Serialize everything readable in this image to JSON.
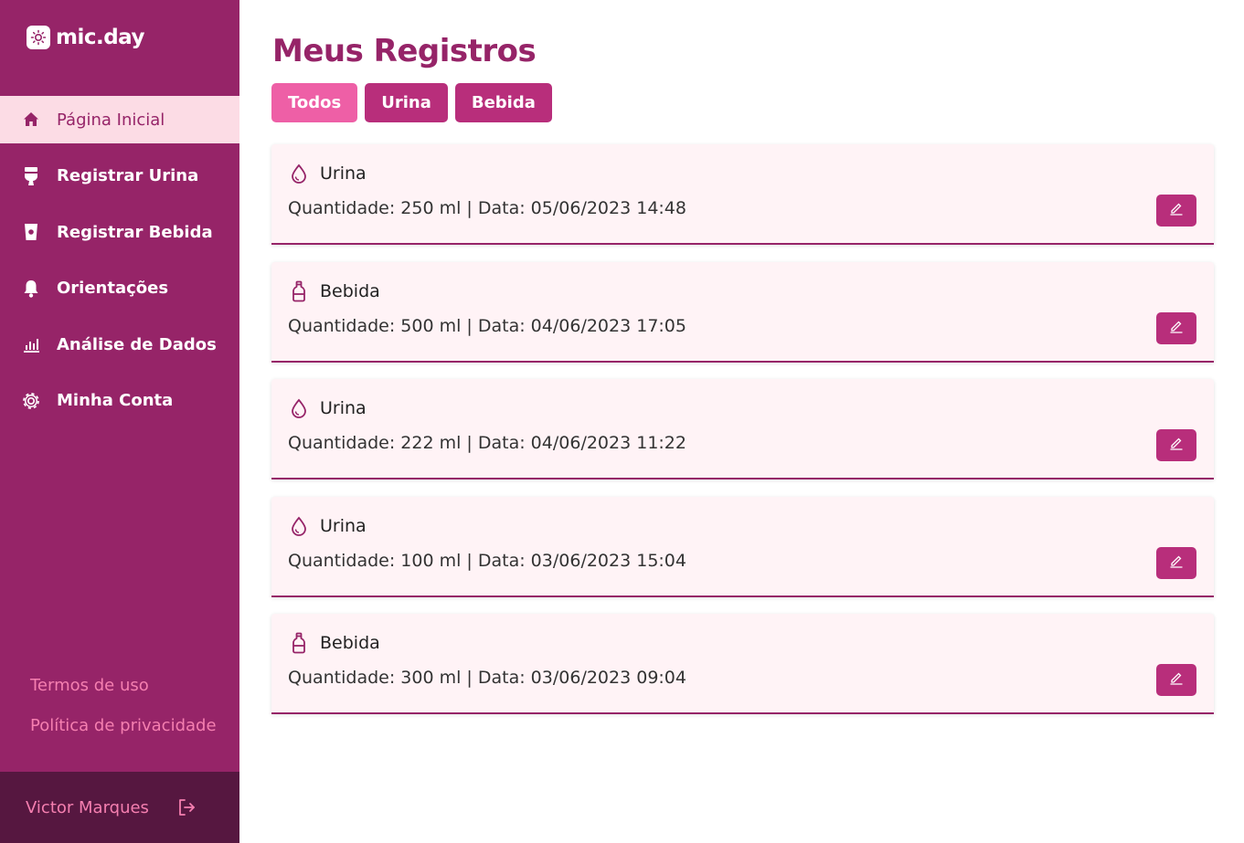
{
  "app": {
    "name": "mic.day",
    "accent": "#962468",
    "accent_light": "#fcdce5",
    "button_color": "#b82e7b",
    "active_filter_color": "#ee5fa6",
    "link_color": "#f57fb0"
  },
  "sidebar": {
    "items": [
      {
        "label": "Página Inicial",
        "icon": "home-icon",
        "active": true
      },
      {
        "label": "Registrar Urina",
        "icon": "toilet-icon",
        "active": false
      },
      {
        "label": "Registrar Bebida",
        "icon": "cup-icon",
        "active": false
      },
      {
        "label": "Orientações",
        "icon": "bell-icon",
        "active": false
      },
      {
        "label": "Análise de Dados",
        "icon": "bar-chart-icon",
        "active": false
      },
      {
        "label": "Minha Conta",
        "icon": "gear-icon",
        "active": false
      }
    ],
    "footer_links": [
      "Termos de uso",
      "Política de privacidade"
    ],
    "user": {
      "name": "Victor Marques",
      "logout_icon": "logout-icon"
    }
  },
  "main": {
    "title": "Meus Registros",
    "filters": [
      {
        "label": "Todos",
        "active": true
      },
      {
        "label": "Urina",
        "active": false
      },
      {
        "label": "Bebida",
        "active": false
      }
    ],
    "records": [
      {
        "type": "Urina",
        "icon": "drop-icon",
        "detail": "Quantidade: 250 ml | Data: 05/06/2023 14:48"
      },
      {
        "type": "Bebida",
        "icon": "bottle-icon",
        "detail": "Quantidade: 500 ml | Data: 04/06/2023 17:05"
      },
      {
        "type": "Urina",
        "icon": "drop-icon",
        "detail": "Quantidade: 222 ml | Data: 04/06/2023 11:22"
      },
      {
        "type": "Urina",
        "icon": "drop-icon",
        "detail": "Quantidade: 100 ml | Data: 03/06/2023 15:04"
      },
      {
        "type": "Bebida",
        "icon": "bottle-icon",
        "detail": "Quantidade: 300 ml | Data: 03/06/2023 09:04"
      }
    ]
  }
}
